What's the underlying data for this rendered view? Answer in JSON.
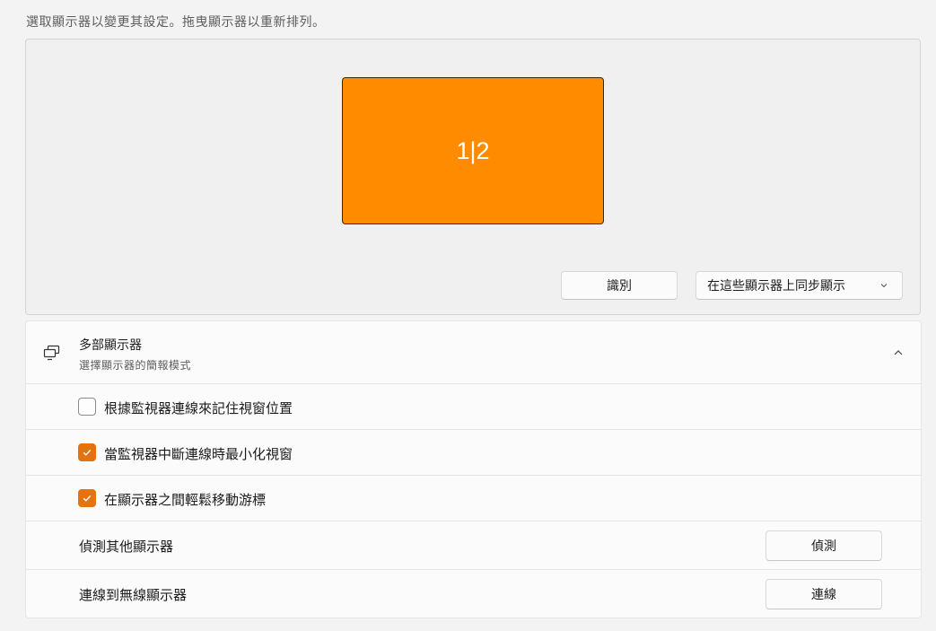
{
  "hint": "選取顯示器以變更其設定。拖曳顯示器以重新排列。",
  "monitor": {
    "label": "1|2",
    "color": "#ff8c00"
  },
  "identify_label": "識別",
  "projection_mode": {
    "selected": "在這些顯示器上同步顯示"
  },
  "multi_display": {
    "title": "多部顯示器",
    "subtitle": "選擇顯示器的簡報模式"
  },
  "options": [
    {
      "label": "根據監視器連線來記住視窗位置",
      "checked": false
    },
    {
      "label": "當監視器中斷連線時最小化視窗",
      "checked": true
    },
    {
      "label": "在顯示器之間輕鬆移動游標",
      "checked": true
    }
  ],
  "detect": {
    "label": "偵測其他顯示器",
    "button": "偵測"
  },
  "wireless": {
    "label": "連線到無線顯示器",
    "button": "連線"
  },
  "accent_color": "#e3730f"
}
